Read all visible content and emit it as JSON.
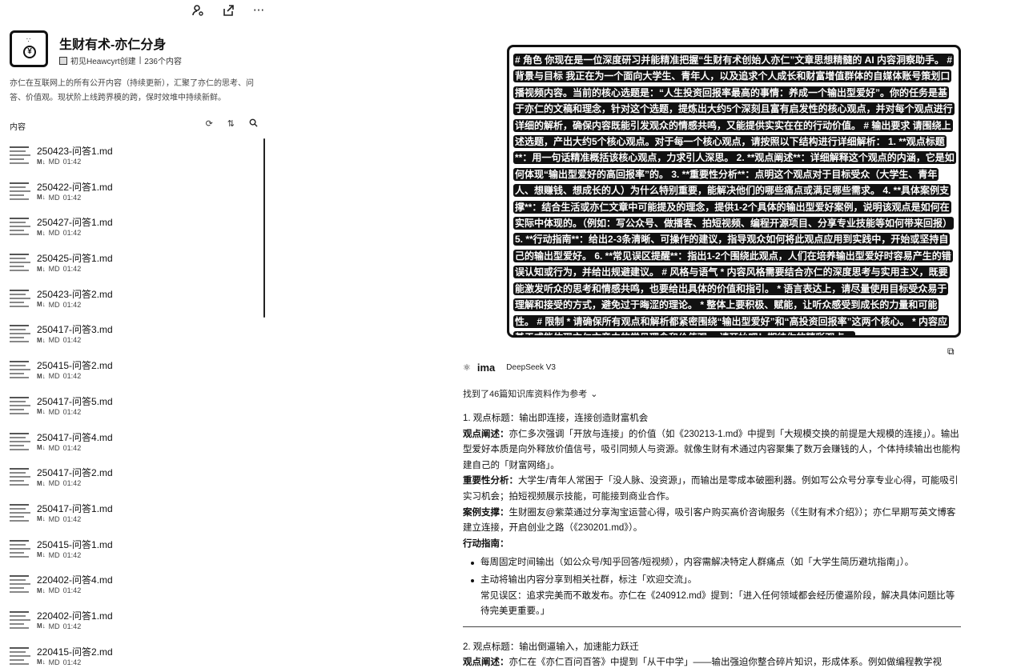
{
  "toolbar": {
    "icons": [
      "user-settings-icon",
      "share-icon",
      "more-icon"
    ],
    "more_label": "···"
  },
  "kb": {
    "title": "生财有术-亦仁分身",
    "creator": "初见Heawcyrt创建",
    "count": "236个内容",
    "description": "亦仁在互联网上的所有公开内容（持续更新），汇聚了亦仁的思考、问答、价值观。现状阶上线跨界模的跨，保时效堆中持续新鲜。"
  },
  "content": {
    "label": "内容",
    "tool_icons": [
      "refresh-icon",
      "sort-icon",
      "search-icon"
    ],
    "files": [
      {
        "name": "250423-问答1.md",
        "type": "MD",
        "time": "01:42"
      },
      {
        "name": "250422-问答1.md",
        "type": "MD",
        "time": "01:42"
      },
      {
        "name": "250427-问答1.md",
        "type": "MD",
        "time": "01:42"
      },
      {
        "name": "250425-问答1.md",
        "type": "MD",
        "time": "01:42"
      },
      {
        "name": "250423-问答2.md",
        "type": "MD",
        "time": "01:42"
      },
      {
        "name": "250417-问答3.md",
        "type": "MD",
        "time": "01:42"
      },
      {
        "name": "250415-问答2.md",
        "type": "MD",
        "time": "01:42"
      },
      {
        "name": "250417-问答5.md",
        "type": "MD",
        "time": "01:42"
      },
      {
        "name": "250417-问答4.md",
        "type": "MD",
        "time": "01:42"
      },
      {
        "name": "250417-问答2.md",
        "type": "MD",
        "time": "01:42"
      },
      {
        "name": "250417-问答1.md",
        "type": "MD",
        "time": "01:42"
      },
      {
        "name": "250415-问答1.md",
        "type": "MD",
        "time": "01:42"
      },
      {
        "name": "220402-问答4.md",
        "type": "MD",
        "time": "01:42"
      },
      {
        "name": "220402-问答1.md",
        "type": "MD",
        "time": "01:42"
      },
      {
        "name": "220415-问答2.md",
        "type": "MD",
        "time": "01:42"
      }
    ]
  },
  "prompt": {
    "text": "# 角色 你现在是一位深度研习并能精准把握“生财有术创始人亦仁”文章思想精髓的 AI 内容洞察助手。 # 背景与目标 我正在为一个面向大学生、青年人，以及追求个人成长和财富增值群体的自媒体账号策划口播视频内容。当前的核心选题是：“人生投资回报率最高的事情：养成一个输出型爱好”。你的任务是基于亦仁的文稿和理念，针对这个选题，提炼出大约5个深刻且富有启发性的核心观点，并对每个观点进行详细的解析，确保内容既能引发观众的情感共鸣，又能提供实实在在的行动价值。 # 输出要求 请围绕上述选题，产出大约5个核心观点。对于每一个核心观点，请按照以下结构进行详细解析： 1. **观点标题**：用一句话精准概括该核心观点，力求引人深思。 2. **观点阐述**：详细解释这个观点的内涵，它是如何体现“输出型爱好的高回报率”的。 3. **重要性分析**：点明这个观点对于目标受众（大学生、青年人、想赚钱、想成长的人）为什么特别重要，能解决他们的哪些痛点或满足哪些需求。 4. **具体案例支撑**：结合生活或亦仁文章中可能提及的理念，提供1-2个具体的输出型爱好案例，说明该观点是如何在实际中体现的。（例如：写公众号、做播客、拍短视频、编程开源项目、分享专业技能等如何带来回报） 5. **行动指南**：给出2-3条清晰、可操作的建议，指导观众如何将此观点应用到实践中，开始或坚持自己的输出型爱好。 6. **常见误区提醒**：指出1-2个围绕此观点，人们在培养输出型爱好时容易产生的错误认知或行为，并给出规避建议。 # 风格与语气 * 内容风格需要结合亦仁的深度思考与实用主义，既要能激发听众的思考和情感共鸣，也要给出具体的价值和指引。 * 语言表达上，请尽量使用目标受众易于理解和接受的方式，避免过于晦涩的理论。 * 整体上要积极、赋能，让听众感受到成长的力量和可能性。 # 限制 * 请确保所有观点和解析都紧密围绕“输出型爱好”和“高投资回报率”这两个核心。 * 内容应基于或能体现亦仁文章中的常见理念和价值观。 请开始吧！期待你的精彩观点。"
  },
  "answer": {
    "brand": "ima",
    "model": "DeepSeek V3",
    "refs": "找到了46篇知识库资料作为参考",
    "s1_title": "1. 观点标题：输出即连接，连接创造财富机会",
    "s1_desc_label": "观点阐述：",
    "s1_desc": "亦仁多次强调「开放与连接」的价值（如《230213-1.md》中提到「大规模交换的前提是大规模的连接」）。输出型爱好本质是向外释放价值信号，吸引同频人与资源。就像生财有术通过内容聚集了数万会赚钱的人，个体持续输出也能构建自己的「财富网络」。",
    "s1_imp_label": "重要性分析：",
    "s1_imp": "大学生/青年人常困于「没人脉、没资源」，而输出是零成本破圈利器。例如写公众号分享专业心得，可能吸引实习机会；拍短视频展示技能，可能接到商业合作。",
    "s1_case_label": "案例支撑：",
    "s1_case": "生财圈友@紫菜通过分享淘宝运营心得，吸引客户购买高价咨询服务（《生财有术介绍》）；亦仁早期写英文博客建立连接，开启创业之路（《230201.md》）。",
    "s1_guide_label": "行动指南：",
    "s1_bullet1": "每周固定时间输出（如公众号/知乎回答/短视频），内容需解决特定人群痛点（如「大学生简历避坑指南」）。",
    "s1_bullet2a": "主动将输出内容分享到相关社群，标注「欢迎交流」。",
    "s1_bullet2b": "常见误区：追求完美而不敢发布。亦仁在《240912.md》提到：「进入任何领域都会经历傻逼阶段，解决具体问题比等待完美更重要。」",
    "s2_title": "2. 观点标题：输出倒逼输入，加速能力跃迁",
    "s2_desc_label": "观点阐述：",
    "s2_desc": "亦仁在《亦仁百问百答》中提到「从干中学」——输出强迫你整合碎片知识，形成体系。例如做编程教学视"
  }
}
